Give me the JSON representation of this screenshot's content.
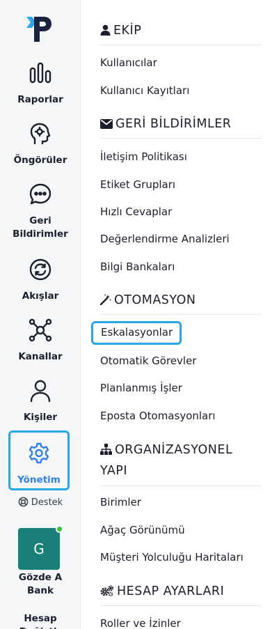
{
  "nav": {
    "items": [
      {
        "label": "Raporlar",
        "icon": "bar-chart-icon"
      },
      {
        "label": "Öngörüler",
        "icon": "head-insight-icon"
      },
      {
        "label": "Geri Bildirimler",
        "icon": "chat-bubble-icon"
      },
      {
        "label": "Akışlar",
        "icon": "refresh-flow-icon"
      },
      {
        "label": "Kanallar",
        "icon": "network-icon"
      },
      {
        "label": "Kişiler",
        "icon": "person-icon"
      },
      {
        "label": "Yönetim",
        "icon": "gear-icon"
      }
    ],
    "active": "Yönetim",
    "support_label": "Destek",
    "avatar_letter": "G",
    "org_name": "Gözde A Bank",
    "switch_account": "Hesap Değiştir"
  },
  "menu": {
    "sections": [
      {
        "title": "EKİP",
        "icon": "user-icon",
        "items": [
          "Kullanıcılar",
          "Kullanıcı Kayıtları"
        ]
      },
      {
        "title": "GERİ BİLDİRİMLER",
        "icon": "envelope-icon",
        "items": [
          "İletişim Politikası",
          "Etiket Grupları",
          "Hızlı Cevaplar",
          "Değerlendirme Analizleri",
          "Bilgi Bankaları"
        ]
      },
      {
        "title": "OTOMASYON",
        "icon": "magic-wand-icon",
        "items": [
          "Eskalasyonlar",
          "Otomatik Görevler",
          "Planlanmış İşler",
          "Eposta Otomasyonları"
        ]
      },
      {
        "title": "ORGANİZASYONEL YAPI",
        "icon": "org-chart-icon",
        "items": [
          "Birimler",
          "Ağaç Görünümü",
          "Müşteri Yolculuğu Haritaları"
        ]
      },
      {
        "title": "HESAP AYARLARI",
        "icon": "gears-icon",
        "items": [
          "Roller ve İzinler"
        ]
      }
    ],
    "highlighted_item": "Eskalasyonlar"
  },
  "colors": {
    "accent": "#2f7ff0",
    "highlight_border": "#2aa5e8",
    "avatar_bg": "#1a8078",
    "online": "#39c23a"
  }
}
